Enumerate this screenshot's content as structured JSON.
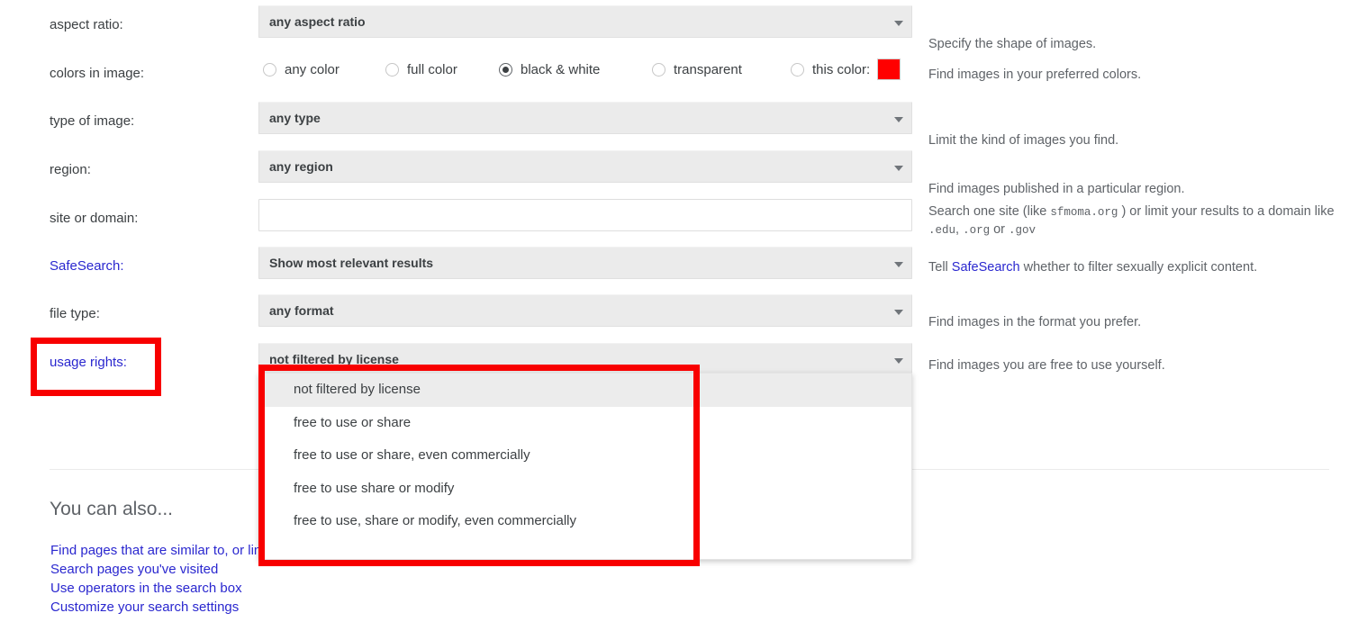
{
  "rows": [
    {
      "label": "aspect ratio:",
      "label_is_link": false,
      "control": "select",
      "value": "any aspect ratio",
      "description": "Specify the shape of images."
    },
    {
      "label": "colors in image:",
      "label_is_link": false,
      "control": "radios",
      "description": "Find images in your preferred colors.",
      "options": [
        {
          "label": "any color",
          "checked": false
        },
        {
          "label": "full color",
          "checked": false
        },
        {
          "label": "black & white",
          "checked": true
        },
        {
          "label": "transparent",
          "checked": false
        },
        {
          "label": "this color:",
          "checked": false,
          "swatch": "#ff0000"
        }
      ]
    },
    {
      "label": "type of image:",
      "label_is_link": false,
      "control": "select",
      "value": "any type",
      "description": "Limit the kind of images you find."
    },
    {
      "label": "region:",
      "label_is_link": false,
      "control": "select",
      "value": "any region",
      "description": "Find images published in a particular region."
    },
    {
      "label": "site or domain:",
      "label_is_link": false,
      "control": "text",
      "value": "",
      "placeholder": "",
      "description_parts": [
        {
          "text": "Search one site (like ",
          "style": "plain"
        },
        {
          "text": "sfmoma.org",
          "style": "mono"
        },
        {
          "text": " ) or limit your results to a domain like ",
          "style": "plain"
        },
        {
          "text": ".edu",
          "style": "mono"
        },
        {
          "text": ", ",
          "style": "plain"
        },
        {
          "text": ".org",
          "style": "mono"
        },
        {
          "text": " or ",
          "style": "plain"
        },
        {
          "text": ".gov",
          "style": "mono"
        }
      ]
    },
    {
      "label": "SafeSearch:",
      "label_is_link": true,
      "control": "select",
      "value": "Show most relevant results",
      "description_parts": [
        {
          "text": "Tell ",
          "style": "plain"
        },
        {
          "text": "SafeSearch",
          "style": "link"
        },
        {
          "text": " whether to filter sexually explicit content.",
          "style": "plain"
        }
      ]
    },
    {
      "label": "file type:",
      "label_is_link": false,
      "control": "select",
      "value": "any format",
      "description": "Find images in the format you prefer."
    },
    {
      "label": "usage rights:",
      "label_is_link": true,
      "control": "select",
      "value": "not filtered by license",
      "description": "Find images you are free to use yourself."
    }
  ],
  "usage_rights_dropdown": {
    "open": true,
    "options": [
      {
        "label": "not filtered by license",
        "selected": true
      },
      {
        "label": "free to use or share",
        "selected": false
      },
      {
        "label": "free to use or share, even commercially",
        "selected": false
      },
      {
        "label": "free to use share or modify",
        "selected": false
      },
      {
        "label": "free to use, share or modify, even commercially",
        "selected": false
      }
    ]
  },
  "footer": {
    "title": "You can also...",
    "links": [
      "Find pages that are similar to, or link to, a URL",
      "Search pages you've visited",
      "Use operators in the search box",
      "Customize your search settings"
    ]
  },
  "annotations": {
    "color": "#f80000",
    "usage_rights_label": "usage rights:",
    "dropdown_menu": "usage rights options menu"
  }
}
